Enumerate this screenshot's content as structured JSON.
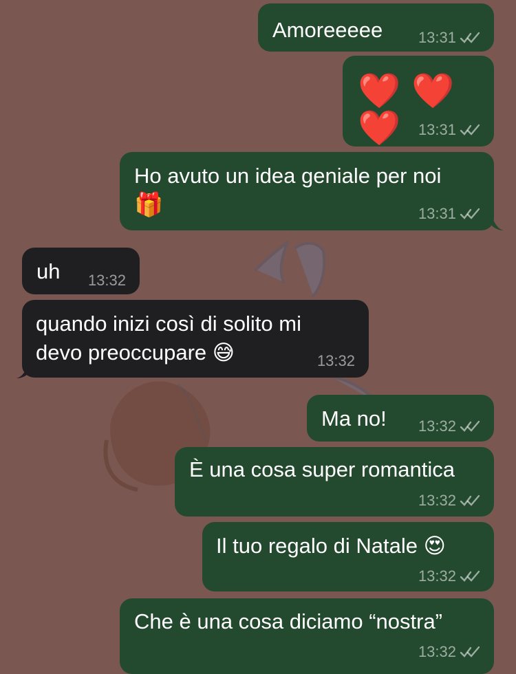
{
  "theme": {
    "wallpaper": "#7b5752",
    "outgoing_bubble": "#23492f",
    "incoming_bubble": "#1f1f21",
    "text": "#ffffff",
    "meta": "rgba(255,255,255,0.55)"
  },
  "messages": [
    {
      "direction": "out",
      "text": "Amoreeeee",
      "time": "13:31",
      "status": "read"
    },
    {
      "direction": "out",
      "text": "❤️ ❤️ ❤️",
      "time": "13:31",
      "status": "read"
    },
    {
      "direction": "out",
      "text": "Ho avuto un idea geniale per noi",
      "text2": "🎁",
      "time": "13:31",
      "status": "read"
    },
    {
      "direction": "in",
      "text": "uh",
      "time": "13:32"
    },
    {
      "direction": "in",
      "text": "quando inizi così di solito mi",
      "text2": "devo preoccupare 😅",
      "time": "13:32"
    },
    {
      "direction": "out",
      "text": "Ma no!",
      "time": "13:32",
      "status": "read"
    },
    {
      "direction": "out",
      "text": "È una cosa super romantica",
      "time": "13:32",
      "status": "read"
    },
    {
      "direction": "out",
      "text": "Il tuo regalo di Natale 😍",
      "time": "13:32",
      "status": "read"
    },
    {
      "direction": "out",
      "text": "Che è una cosa diciamo “nostra”",
      "time": "13:32",
      "status": "read"
    }
  ]
}
